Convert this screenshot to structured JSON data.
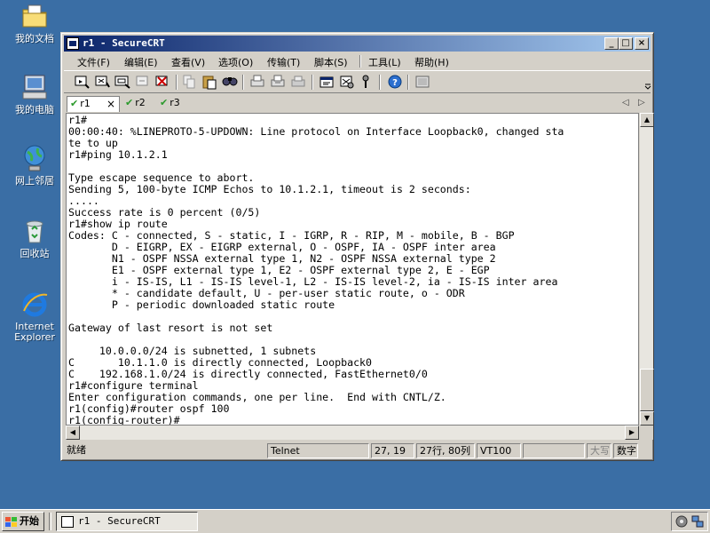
{
  "desktop": {
    "icons": [
      {
        "label": "我的文档",
        "icon": "folder-documents-icon"
      },
      {
        "label": "我的电脑",
        "icon": "computer-icon"
      },
      {
        "label": "网上邻居",
        "icon": "network-icon"
      },
      {
        "label": "回收站",
        "icon": "recycle-bin-icon"
      },
      {
        "label": "Internet Explorer",
        "icon": "internet-explorer-icon"
      }
    ]
  },
  "window": {
    "title": "r1 - SecureCRT",
    "minimize": "_",
    "maximize": "□",
    "close": "×"
  },
  "menu": [
    "文件(F)",
    "编辑(E)",
    "查看(V)",
    "选项(O)",
    "传输(T)",
    "脚本(S)",
    "工具(L)",
    "帮助(H)"
  ],
  "tabs": {
    "items": [
      "r1",
      "r2",
      "r3"
    ],
    "close": "×",
    "prev": "◁",
    "next": "▷"
  },
  "terminal": {
    "lines": [
      "r1#",
      "00:00:40: %LINEPROTO-5-UPDOWN: Line protocol on Interface Loopback0, changed sta",
      "te to up",
      "r1#ping 10.1.2.1",
      "",
      "Type escape sequence to abort.",
      "Sending 5, 100-byte ICMP Echos to 10.1.2.1, timeout is 2 seconds:",
      ".....",
      "Success rate is 0 percent (0/5)",
      "r1#show ip route",
      "Codes: C - connected, S - static, I - IGRP, R - RIP, M - mobile, B - BGP",
      "       D - EIGRP, EX - EIGRP external, O - OSPF, IA - OSPF inter area",
      "       N1 - OSPF NSSA external type 1, N2 - OSPF NSSA external type 2",
      "       E1 - OSPF external type 1, E2 - OSPF external type 2, E - EGP",
      "       i - IS-IS, L1 - IS-IS level-1, L2 - IS-IS level-2, ia - IS-IS inter area",
      "       * - candidate default, U - per-user static route, o - ODR",
      "       P - periodic downloaded static route",
      "",
      "Gateway of last resort is not set",
      "",
      "     10.0.0.0/24 is subnetted, 1 subnets",
      "C       10.1.1.0 is directly connected, Loopback0",
      "C    192.168.1.0/24 is directly connected, FastEthernet0/0",
      "r1#configure terminal",
      "Enter configuration commands, one per line.  End with CNTL/Z.",
      "r1(config)#router ospf 100",
      "r1(config-router)#"
    ]
  },
  "status": {
    "ready": "就绪",
    "protocol": "Telnet",
    "cursor_pos": "27, 19",
    "rows_cols": "27行, 80列",
    "emulation": "VT100",
    "caps": "大写",
    "num": "数字"
  },
  "taskbar": {
    "start": "开始",
    "task": "r1 - SecureCRT"
  }
}
